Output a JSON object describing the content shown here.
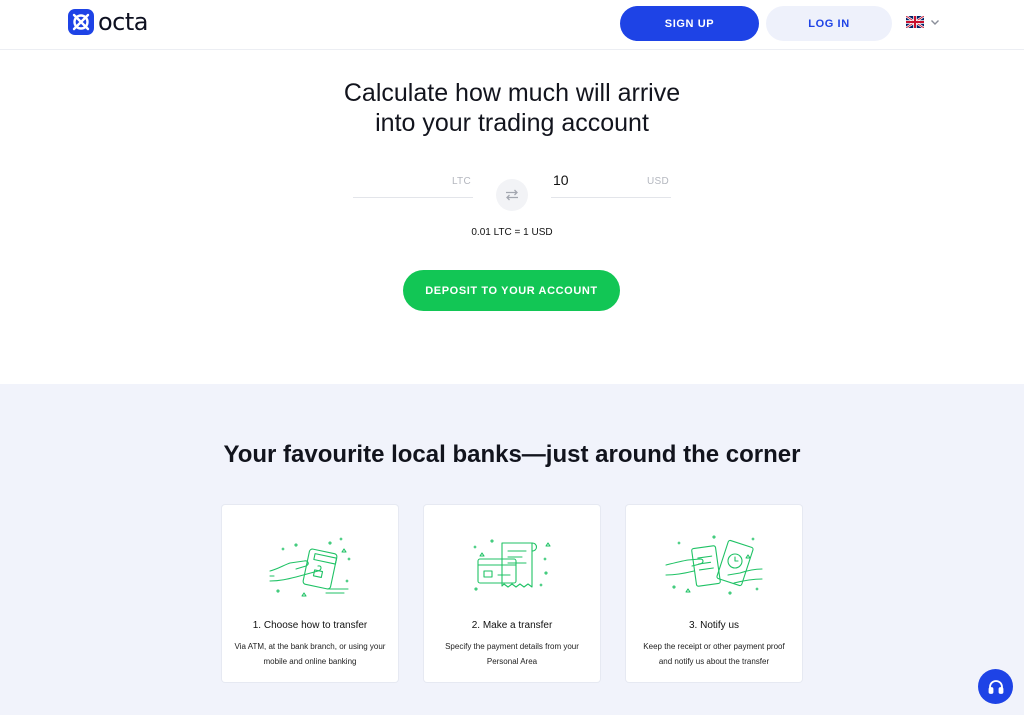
{
  "header": {
    "logo_text": "octa",
    "signup_label": "SIGN UP",
    "login_label": "LOG IN",
    "language": "flag-uk-icon"
  },
  "calculator": {
    "title_line1": "Calculate how much will arrive",
    "title_line2": "into your trading account",
    "from_value": "",
    "from_currency": "LTC",
    "to_value": "10",
    "to_currency": "USD",
    "rate": "0.01 LTC = 1 USD",
    "deposit_label": "DEPOSIT TO YOUR ACCOUNT"
  },
  "banks": {
    "title": "Your favourite local banks—just around the corner",
    "steps": [
      {
        "title": "1. Choose how to transfer",
        "text": "Via ATM, at the bank branch, or using your mobile and online banking",
        "icon": "hand-card-icon"
      },
      {
        "title": "2. Make a transfer",
        "text": "Specify the payment details from your Personal Area",
        "icon": "card-receipt-icon"
      },
      {
        "title": "3. Notify us",
        "text": "Keep the receipt or other payment proof and notify us about the transfer",
        "icon": "hands-receipt-icon"
      }
    ]
  },
  "colors": {
    "brand_blue": "#1e43e6",
    "deposit_green": "#12c655",
    "section_bg": "#f1f3fb",
    "illustration_green": "#1fc265"
  }
}
